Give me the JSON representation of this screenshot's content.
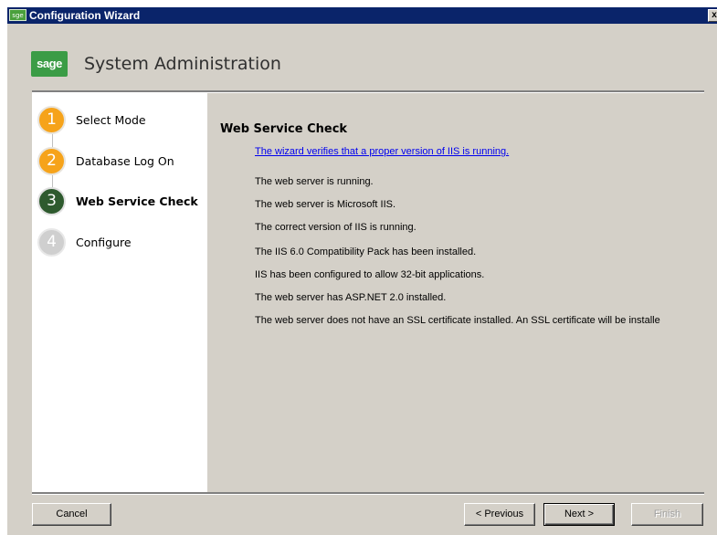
{
  "window": {
    "title": "Configuration Wizard",
    "icon_text": "sge",
    "close_glyph": "x"
  },
  "header": {
    "logo_text": "sage",
    "app_title": "System Administration"
  },
  "steps": [
    {
      "number": "1",
      "label": "Select Mode",
      "state": "complete"
    },
    {
      "number": "2",
      "label": "Database Log On",
      "state": "complete"
    },
    {
      "number": "3",
      "label": "Web Service Check",
      "state": "active"
    },
    {
      "number": "4",
      "label": "Configure",
      "state": "pending"
    }
  ],
  "content": {
    "title": "Web Service Check",
    "intro_link": "The wizard verifies that a proper version of IIS is running.",
    "messages": [
      "The web server is running.",
      "The web server is Microsoft IIS.",
      "The correct version of IIS is running.",
      "The IIS 6.0 Compatibility Pack has been installed.",
      "IIS has been configured to allow 32-bit applications.",
      "The web server has ASP.NET 2.0 installed.",
      "The web server does not have an SSL certificate installed. An SSL certificate will be installe"
    ]
  },
  "buttons": {
    "cancel": "Cancel",
    "previous": "< Previous",
    "next": "Next >",
    "finish": "Finish"
  },
  "colors": {
    "titlebar": "#0a246a",
    "step_complete": "#f6a31a",
    "step_active": "#2e5a2e",
    "step_pending": "#cfcfcf",
    "logo": "#3b9c46",
    "link": "#0000ee"
  }
}
